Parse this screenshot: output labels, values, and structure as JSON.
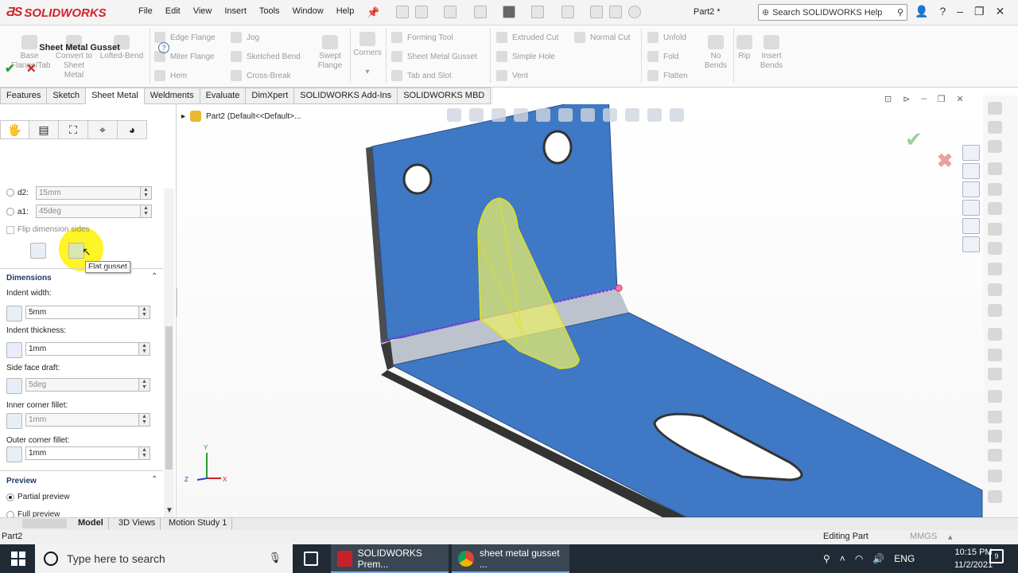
{
  "app": {
    "brand": "SOLIDWORKS",
    "menus": [
      "File",
      "Edit",
      "View",
      "Insert",
      "Tools",
      "Window",
      "Help"
    ],
    "doc_title": "Part2 *",
    "search_placeholder": "Search SOLIDWORKS Help"
  },
  "commands": {
    "base_flange": "Base Flange/Tab",
    "convert": "Convert to Sheet Metal",
    "lofted_bend": "Lofted-Bend",
    "edge_flange": "Edge Flange",
    "miter_flange": "Miter Flange",
    "hem": "Hem",
    "jog": "Jog",
    "sketched_bend": "Sketched Bend",
    "cross_break": "Cross-Break",
    "swept_flange": "Swept Flange",
    "corners": "Corners",
    "forming_tool": "Forming Tool",
    "sheet_metal_gusset": "Sheet Metal Gusset",
    "tab_and_slot": "Tab and Slot",
    "extruded_cut": "Extruded Cut",
    "simple_hole": "Simple Hole",
    "vent": "Vent",
    "normal_cut": "Normal Cut",
    "unfold": "Unfold",
    "fold": "Fold",
    "flatten": "Flatten",
    "no_bends": "No Bends",
    "rip": "Rip",
    "insert_bends": "Insert Bends"
  },
  "tabs": [
    "Features",
    "Sketch",
    "Sheet Metal",
    "Weldments",
    "Evaluate",
    "DimXpert",
    "SOLIDWORKS Add-Ins",
    "SOLIDWORKS MBD"
  ],
  "active_tab": "Sheet Metal",
  "property_manager": {
    "title": "Sheet Metal Gusset",
    "help": "?",
    "d2_label": "d2:",
    "d2_value": "15mm",
    "a1_label": "a1:",
    "a1_value": "45deg",
    "flip_label": "Flip dimension sides",
    "tooltip": "Flat gusset",
    "dimensions_header": "Dimensions",
    "indent_width_label": "Indent width:",
    "indent_width_value": "5mm",
    "indent_thickness_label": "Indent thickness:",
    "indent_thickness_value": "1mm",
    "side_face_draft_label": "Side face draft:",
    "side_face_draft_value": "5deg",
    "inner_fillet_label": "Inner corner fillet:",
    "inner_fillet_value": "1mm",
    "outer_fillet_label": "Outer corner fillet:",
    "outer_fillet_value": "1mm",
    "preview_header": "Preview",
    "partial_preview": "Partial preview",
    "full_preview": "Full preview"
  },
  "graphics": {
    "tree_item": "Part2  (Default<<Default>...",
    "colors": {
      "sheet_blue": "#3f78c4",
      "gusset_yellow": "#e8ec6a",
      "bend_line": "#8a2be2"
    }
  },
  "bottom_tabs": [
    "Model",
    "3D Views",
    "Motion Study 1"
  ],
  "status": {
    "left": "Part2",
    "mode": "Editing Part",
    "units": "MMGS"
  },
  "taskbar": {
    "search": "Type here to search",
    "app1": "SOLIDWORKS Prem...",
    "app2": "sheet metal gusset ...",
    "lang": "ENG",
    "time": "10:15 PM",
    "date": "11/2/2021",
    "notif": "9"
  }
}
